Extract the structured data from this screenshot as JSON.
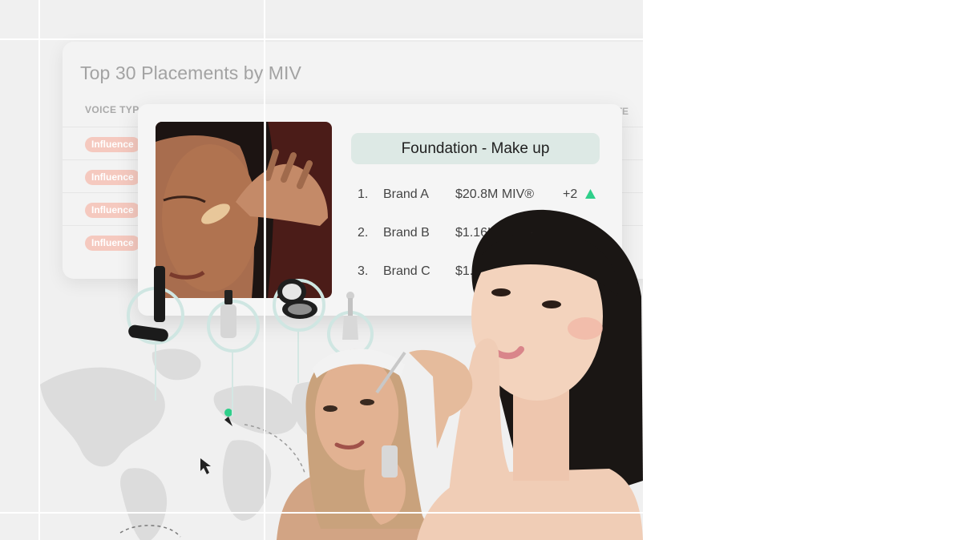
{
  "placements_table": {
    "title": "Top 30 Placements by MIV",
    "column_voice_type": "VOICE TYP",
    "column_last": "TE",
    "rows": [
      {
        "voice_type": "Influence"
      },
      {
        "voice_type": "Influence"
      },
      {
        "voice_type": "Influence"
      },
      {
        "voice_type": "Influence"
      }
    ]
  },
  "ranking_card": {
    "heading": "Foundation - Make up",
    "entries": [
      {
        "rank": "1.",
        "brand": "Brand A",
        "value": "$20.8M MIV®",
        "change": "+2"
      },
      {
        "rank": "2.",
        "brand": "Brand B",
        "value": "$1.16K M"
      },
      {
        "rank": "3.",
        "brand": "Brand C",
        "value": "$1.0"
      }
    ]
  },
  "colors": {
    "pill_bg": "#f5c9bf",
    "heading_bg": "#dde9e5",
    "up_arrow": "#2fcf8a",
    "ring": "#cfe6e2",
    "canvas": "#f0f0f0"
  },
  "icons": {
    "change_indicator": "up-triangle-icon",
    "cursor": "mouse-pointer-icon",
    "map_pin": "map-pin-icon"
  }
}
